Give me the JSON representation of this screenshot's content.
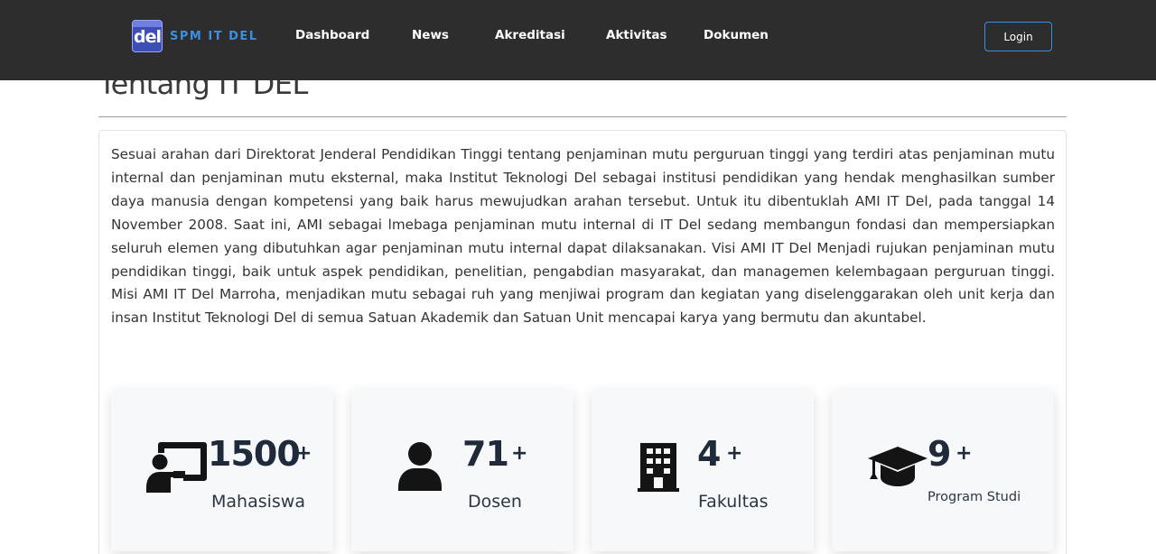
{
  "brand": {
    "logo_text": "del",
    "name": "SPM IT DEL"
  },
  "nav": {
    "items": [
      {
        "label": "Dashboard"
      },
      {
        "label": "News"
      },
      {
        "label": "Akreditasi"
      },
      {
        "label": "Aktivitas"
      },
      {
        "label": "Dokumen"
      }
    ],
    "login_label": "Login"
  },
  "about": {
    "title": "Tentang IT DEL",
    "paragraph": "Sesuai arahan dari Direktorat Jenderal Pendidikan Tinggi tentang penjaminan mutu perguruan tinggi yang terdiri atas penjaminan mutu internal dan penjaminan mutu eksternal, maka Institut Teknologi Del sebagai institusi pendidikan yang hendak menghasilkan sumber daya manusia dengan kompetensi yang baik harus mewujudkan arahan tersebut. Untuk itu dibentuklah AMI IT Del, pada tanggal 14 November 2008. Saat ini, AMI sebagai lmebaga penjaminan mutu internal di IT Del sedang membangun fondasi dan mempersiapkan seluruh elemen yang dibutuhkan agar penjaminan mutu internal dapat dilaksanakan. Visi AMI IT Del Menjadi rujukan penjaminan mutu pendidikan tinggi, baik untuk aspek pendidikan, penelitian, pengabdian masyarakat, dan managemen kelembagaan perguruan tinggi. Misi AMI IT Del Marroha, menjadikan mutu sebagai ruh yang menjiwai program dan kegiatan yang diselenggarakan oleh unit kerja dan insan Institut Teknologi Del di semua Satuan Akademik dan Satuan Unit mencapai karya yang bermutu dan akuntabel."
  },
  "stats": [
    {
      "icon": "teacher-board-icon",
      "value": "1500",
      "suffix": "+",
      "label": "Mahasiswa"
    },
    {
      "icon": "user-icon",
      "value": "71",
      "suffix": "+",
      "label": "Dosen"
    },
    {
      "icon": "building-icon",
      "value": "4",
      "suffix": "+",
      "label": "Fakultas"
    },
    {
      "icon": "graduation-cap-icon",
      "value": "9",
      "suffix": "+",
      "label": "Program Studi"
    }
  ],
  "colors": {
    "navbar_bg": "#2d2d2d",
    "brand_accent": "#3d8ee0",
    "stat_text": "#1f2a3a",
    "card_bg": "#f7f8fa"
  }
}
